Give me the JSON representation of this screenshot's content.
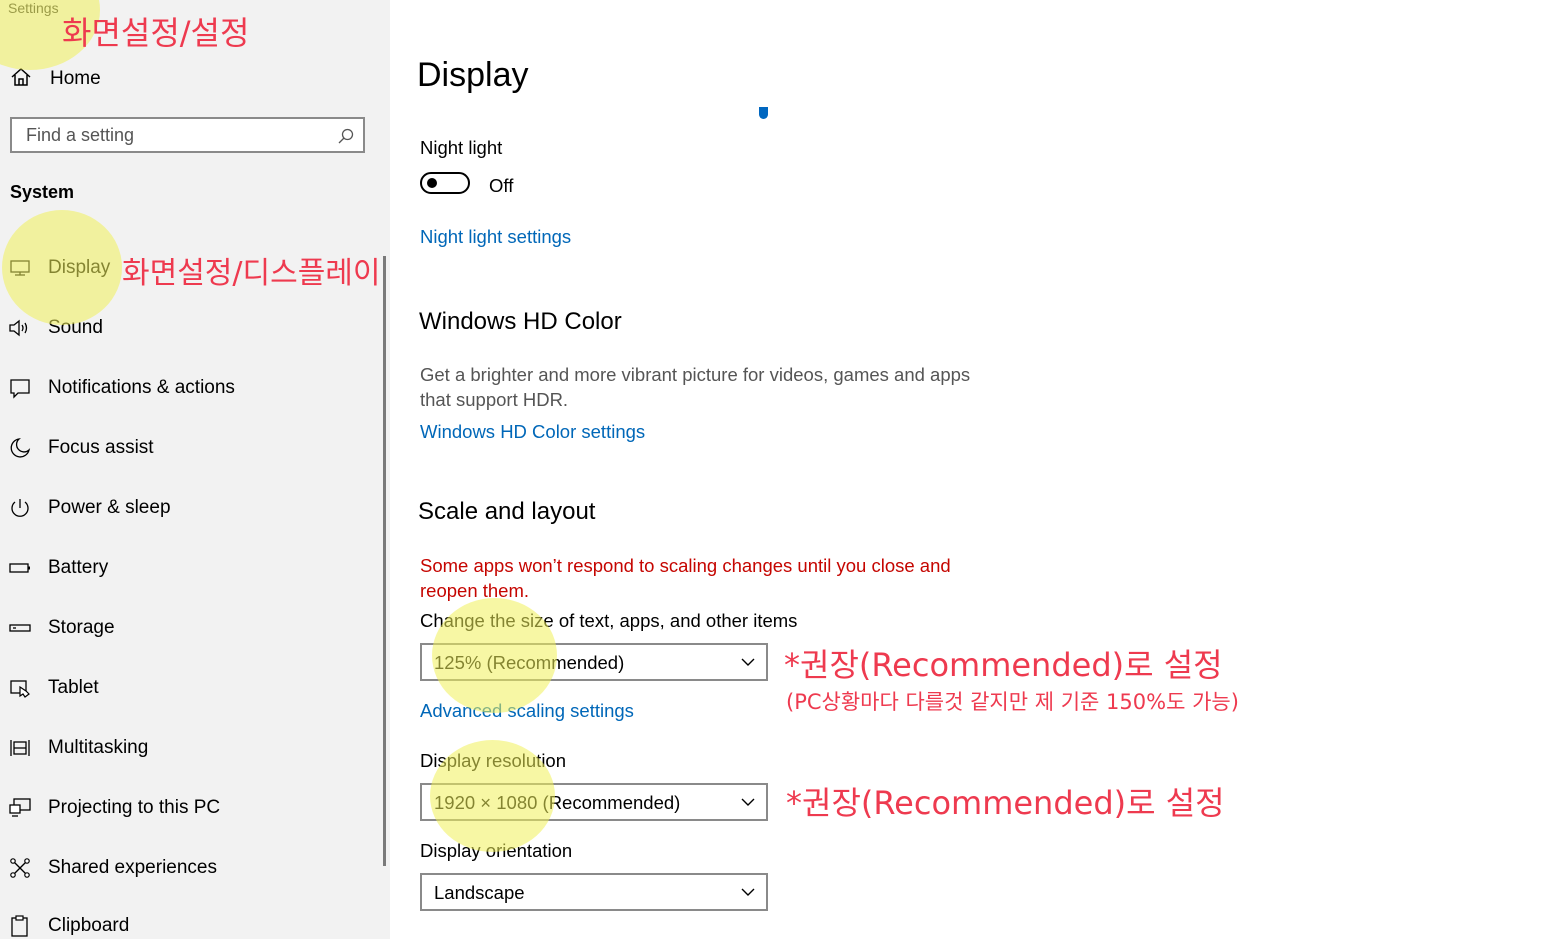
{
  "app": {
    "title": "Settings"
  },
  "sidebar": {
    "home_label": "Home",
    "search_placeholder": "Find a setting",
    "section": "System",
    "items": [
      {
        "label": "Display",
        "icon": "monitor-icon"
      },
      {
        "label": "Sound",
        "icon": "speaker-icon"
      },
      {
        "label": "Notifications & actions",
        "icon": "message-icon"
      },
      {
        "label": "Focus assist",
        "icon": "moon-icon"
      },
      {
        "label": "Power & sleep",
        "icon": "power-icon"
      },
      {
        "label": "Battery",
        "icon": "battery-icon"
      },
      {
        "label": "Storage",
        "icon": "storage-icon"
      },
      {
        "label": "Tablet",
        "icon": "tablet-icon"
      },
      {
        "label": "Multitasking",
        "icon": "multitasking-icon"
      },
      {
        "label": "Projecting to this PC",
        "icon": "projecting-icon"
      },
      {
        "label": "Shared experiences",
        "icon": "shared-icon"
      },
      {
        "label": "Clipboard",
        "icon": "clipboard-icon"
      }
    ]
  },
  "main": {
    "title": "Display",
    "night_light": {
      "label": "Night light",
      "state": "Off",
      "link": "Night light settings"
    },
    "hdr": {
      "heading": "Windows HD Color",
      "description": "Get a brighter and more vibrant picture for videos, games and apps that support HDR.",
      "link": "Windows HD Color settings"
    },
    "scale": {
      "heading": "Scale and layout",
      "warning": "Some apps won’t respond to scaling changes until you close and reopen them.",
      "size_label": "Change the size of text, apps, and other items",
      "size_value": "125% (Recommended)",
      "advanced_link": "Advanced scaling settings",
      "resolution_label": "Display resolution",
      "resolution_value": "1920 × 1080 (Recommended)",
      "orientation_label": "Display orientation",
      "orientation_value": "Landscape"
    }
  },
  "annotations": {
    "settings_note": "화면설정/설정",
    "display_note": "화면설정/디스플레이",
    "scale_note": "*권장(Recommended)로 설정",
    "scale_subnote": "(PC상황마다 다를것 같지만 제 기준 150%도 가능)",
    "resolution_note": "*권장(Recommended)로 설정"
  },
  "colors": {
    "link": "#0067b8",
    "warning": "#c50500",
    "highlight": "#f0f05a",
    "annotation": "#ee3a4f"
  }
}
